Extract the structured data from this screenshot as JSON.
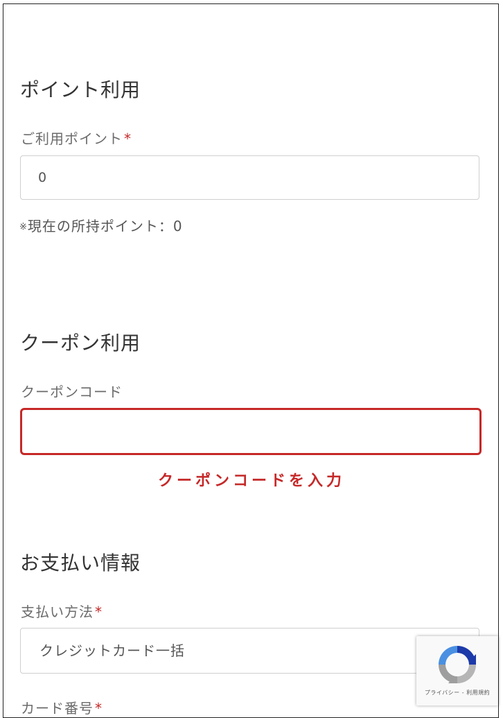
{
  "points_section": {
    "title": "ポイント利用",
    "label": "ご利用ポイント",
    "required_mark": "*",
    "input_value": "0",
    "current_points_prefix": "※",
    "current_points_text": "現在の所持ポイント：0"
  },
  "coupon_section": {
    "title": "クーポン利用",
    "label": "クーポンコード",
    "input_value": "",
    "error_message": "クーポンコードを入力"
  },
  "payment_section": {
    "title": "お支払い情報",
    "method_label": "支払い方法",
    "required_mark": "*",
    "method_value": "クレジットカード一括",
    "card_label": "カード番号",
    "card_required_mark": "*"
  },
  "recaptcha": {
    "links_text": "プライバシー - 利用規約",
    "icon": "recaptcha-logo-icon"
  },
  "colors": {
    "accent_error": "#c62828",
    "text": "#333333",
    "border": "#cfcfcf"
  }
}
